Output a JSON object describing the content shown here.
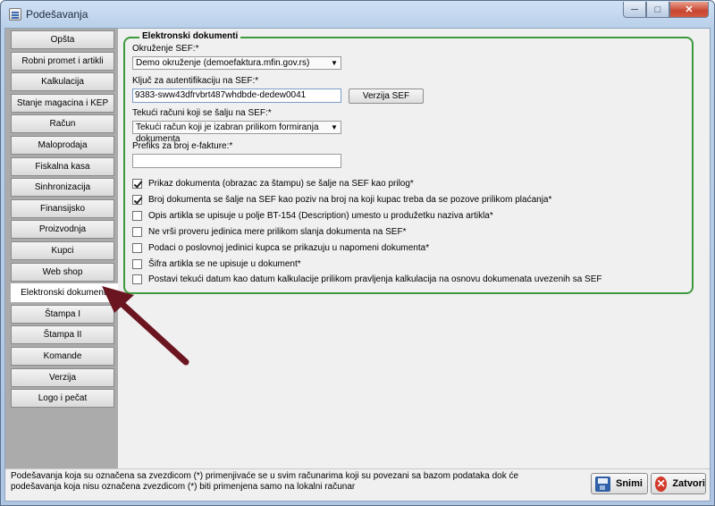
{
  "window": {
    "title": "Podešavanja"
  },
  "sidebar": {
    "items": [
      {
        "label": "Opšta"
      },
      {
        "label": "Robni promet i artikli"
      },
      {
        "label": "Kalkulacija"
      },
      {
        "label": "Stanje magacina i KEP"
      },
      {
        "label": "Račun"
      },
      {
        "label": "Maloprodaja"
      },
      {
        "label": "Fiskalna kasa"
      },
      {
        "label": "Sinhronizacija"
      },
      {
        "label": "Finansijsko"
      },
      {
        "label": "Proizvodnja"
      },
      {
        "label": "Kupci"
      },
      {
        "label": "Web shop"
      },
      {
        "label": "Elektronski dokumenti",
        "active": true
      },
      {
        "label": "Štampa I"
      },
      {
        "label": "Štampa II"
      },
      {
        "label": "Komande"
      },
      {
        "label": "Verzija"
      },
      {
        "label": "Logo i pečat"
      }
    ]
  },
  "group": {
    "title": "Elektronski dokumenti",
    "env_label": "Okruženje SEF:*",
    "env_value": "Demo okruženje (demoefaktura.mfin.gov.rs)",
    "key_label": "Ključ za autentifikaciju na SEF:*",
    "key_value": "9383-sww43dfrvbrt487whdbde-dedew0041",
    "version_button": "Verzija SEF",
    "invoices_label": "Tekući računi koji se šalju na SEF:*",
    "invoices_value": "Tekući račun koji je izabran prilikom formiranja dokumenta",
    "prefix_label": "Prefiks za broj e-fakture:*",
    "prefix_value": "",
    "checkboxes": [
      {
        "label": "Prikaz dokumenta (obrazac za štampu) se šalje na SEF kao prilog*",
        "checked": true
      },
      {
        "label": "Broj dokumenta se šalje na SEF kao poziv na broj na koji kupac treba da se pozove prilikom plaćanja*",
        "checked": true
      },
      {
        "label": "Opis artikla se upisuje u polje BT-154 (Description) umesto u produžetku naziva artikla*",
        "checked": false
      },
      {
        "label": "Ne vrši proveru jedinica mere prilikom slanja dokumenta  na SEF*",
        "checked": false
      },
      {
        "label": "Podaci o poslovnoj jedinici kupca se prikazuju u napomeni dokumenta*",
        "checked": false
      },
      {
        "label": "Šifra artikla se ne upisuje u dokument*",
        "checked": false
      },
      {
        "label": "Postavi tekući datum kao datum kalkulacije prilikom pravljenja kalkulacija na osnovu dokumenata uvezenih sa SEF",
        "checked": false
      }
    ]
  },
  "footer": {
    "note": "Podešavanja koja su označena sa zvezdicom (*) primenjivaće se u svim računarima koji su povezani sa bazom podataka dok će podešavanja koja nisu označena zvezdicom (*) biti primenjena samo na lokalni računar",
    "save_label": "Snimi",
    "close_label": "Zatvori"
  },
  "colors": {
    "group_border": "#3c9a3c",
    "arrow": "#6b1520",
    "sidebar_bg": "#ababab"
  }
}
